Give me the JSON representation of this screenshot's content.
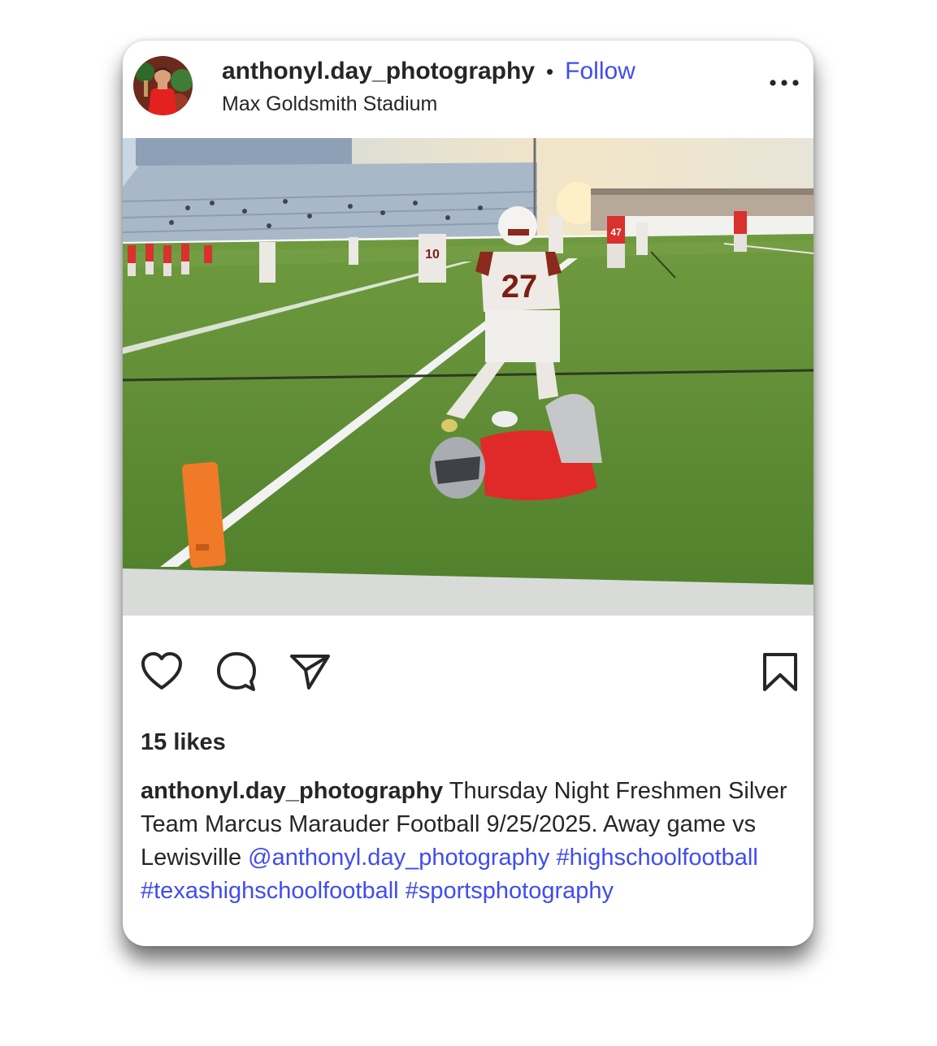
{
  "post": {
    "username": "anthonyl.day_photography",
    "separator": "•",
    "follow_label": "Follow",
    "location": "Max Goldsmith Stadium",
    "more_icon": "ellipsis-icon",
    "likes": "15 likes",
    "caption": {
      "username": "anthonyl.day_photography",
      "text": "Thursday Night Freshmen Silver Team Marcus Marauder Football 9/25/2025. Away game vs Lewisville",
      "mention": "@anthonyl.day_photography",
      "hashtags": [
        "#highschoolfootball",
        "#texashighschoolfootball",
        "#sportsphotography"
      ]
    },
    "photo": {
      "jersey_front": "27",
      "jersey_back": "10",
      "jersey_red": "47"
    },
    "actions": [
      "heart-icon",
      "comment-icon",
      "share-icon",
      "bookmark-icon"
    ]
  },
  "colors": {
    "link": "#3f4cf2",
    "text": "#262626",
    "turf": "#5e8f35",
    "pylon": "#f07a28",
    "red_jersey": "#e02a2a"
  }
}
